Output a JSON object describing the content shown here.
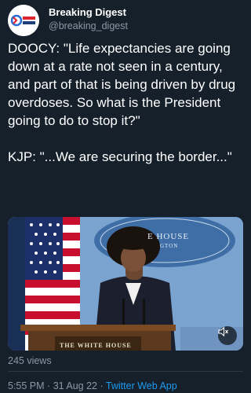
{
  "author": {
    "display_name": "Breaking Digest",
    "handle": "@breaking_digest",
    "avatar_logo_text": "BREAKING DIGEST"
  },
  "tweet": {
    "text": "DOOCY: \"Life expectancies are going down at a rate not seen in a century, and part of that is being driven by drug overdoses. So what is the President going to do to stop it?\"\n\nKJP: \"...We are securing the border...\""
  },
  "media": {
    "type": "video",
    "backdrop_text_line1": "E  HOUSE",
    "backdrop_text_line2": "GTON",
    "podium_text": "THE WHITE HOUSE",
    "mute_icon": "speaker-muted-icon"
  },
  "stats": {
    "views": "245 views"
  },
  "meta": {
    "time": "5:55 PM",
    "separator": "·",
    "date": "31 Aug 22",
    "source": "Twitter Web App"
  },
  "colors": {
    "background": "#15202b",
    "text_primary": "#ffffff",
    "text_secondary": "#8b98a5",
    "link": "#1d9bf0"
  }
}
